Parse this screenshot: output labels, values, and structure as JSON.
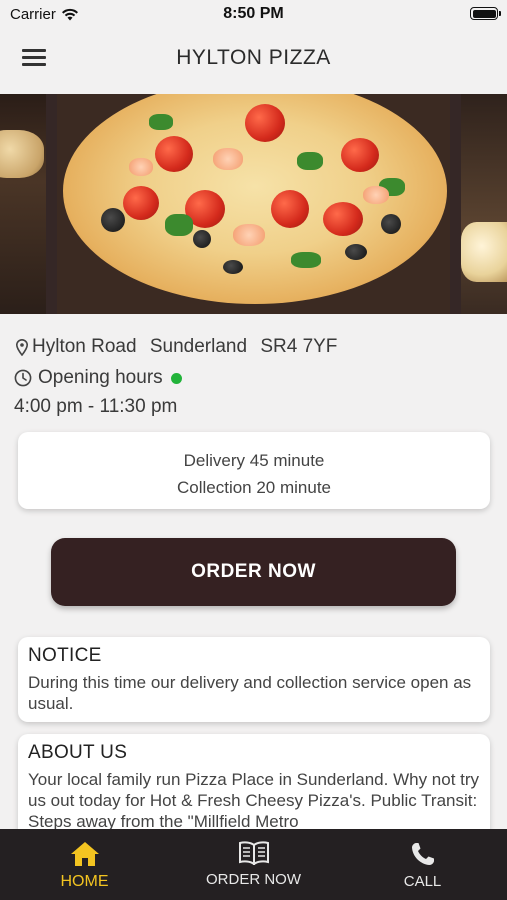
{
  "status_bar": {
    "carrier": "Carrier",
    "time": "8:50 PM"
  },
  "nav": {
    "title": "HYLTON PIZZA",
    "menu_icon": "hamburger-menu-icon"
  },
  "location": {
    "road": "Hylton Road",
    "city": "Sunderland",
    "postcode": "SR4 7YF",
    "icon": "map-pin-icon"
  },
  "hours": {
    "label": "Opening hours",
    "status_color": "#22b33a",
    "range": "4:00 pm - 11:30 pm",
    "icon": "clock-icon"
  },
  "times": {
    "delivery": "Delivery 45 minute",
    "collection": "Collection 20 minute"
  },
  "order_button": {
    "label": "ORDER NOW",
    "color": "#352122"
  },
  "notice": {
    "title": "NOTICE",
    "body": "During this time our delivery and collection service open as usual."
  },
  "about": {
    "title": "ABOUT US",
    "body": "Your local family run Pizza Place in Sunderland. Why not try us out today for Hot & Fresh Cheesy Pizza's. Public Transit: Steps away from the \"Millfield Metro"
  },
  "tabs": [
    {
      "label": "HOME",
      "icon": "home-icon",
      "active": true
    },
    {
      "label": "ORDER NOW",
      "icon": "menu-book-icon",
      "active": false
    },
    {
      "label": "CALL",
      "icon": "phone-icon",
      "active": false
    }
  ],
  "colors": {
    "accent": "#f3c421",
    "tab_bar": "#242022"
  }
}
